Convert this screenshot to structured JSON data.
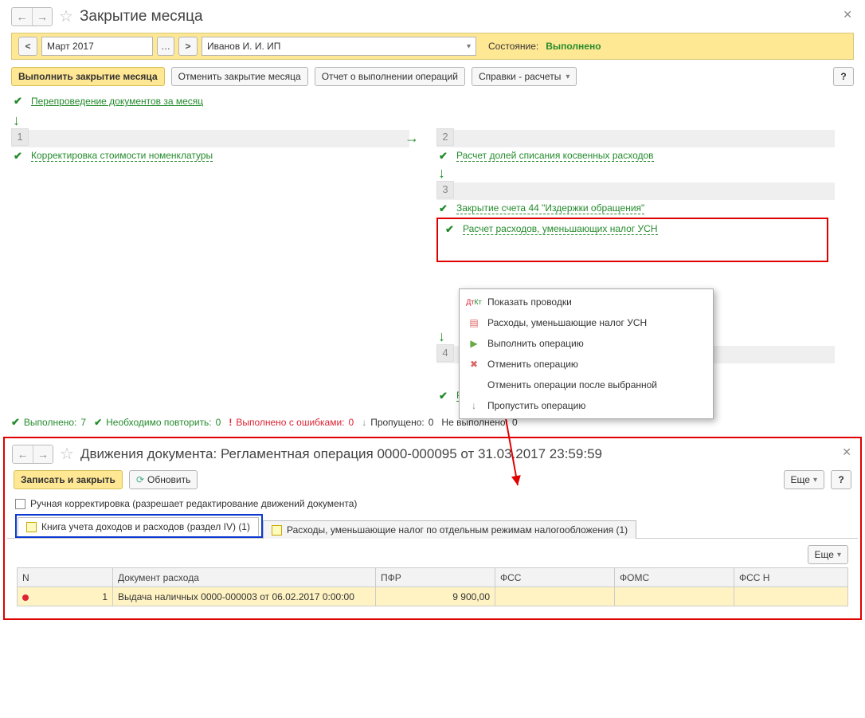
{
  "header": {
    "title": "Закрытие месяца"
  },
  "bar1": {
    "period": "Март 2017",
    "org": "Иванов И. И. ИП",
    "state_label": "Состояние:",
    "state_value": "Выполнено"
  },
  "bar2": {
    "run": "Выполнить закрытие месяца",
    "cancel": "Отменить закрытие месяца",
    "report": "Отчет о выполнении операций",
    "refs": "Справки - расчеты",
    "help": "?"
  },
  "steps": {
    "reposting": "Перепроведение документов за месяц",
    "s1": "Корректировка стоимости номенклатуры",
    "s2": "Расчет долей списания косвенных расходов",
    "s3a": "Закрытие счета 44 \"Издержки обращения\"",
    "s3b": "Расчет расходов, уменьшающих налог УСН",
    "s4": "Расчет налога УСН"
  },
  "menu": {
    "m1": "Показать проводки",
    "m2": "Расходы, уменьшающие налог УСН",
    "m3": "Выполнить операцию",
    "m4": "Отменить операцию",
    "m5": "Отменить операции после выбранной",
    "m6": "Пропустить операцию"
  },
  "statusbar": {
    "done": "Выполнено:",
    "done_n": "7",
    "repeat": "Необходимо повторить:",
    "repeat_n": "0",
    "err": "Выполнено с ошибками:",
    "err_n": "0",
    "skip": "Пропущено:",
    "skip_n": "0",
    "nd": "Не выполнено:",
    "nd_n": "0"
  },
  "panel2": {
    "title": "Движения документа: Регламентная операция 0000-000095 от 31.03.2017 23:59:59",
    "save": "Записать и закрыть",
    "refresh": "Обновить",
    "more": "Еще",
    "help": "?",
    "manual": "Ручная корректировка (разрешает редактирование движений документа)",
    "tab1": "Книга учета доходов и расходов (раздел IV) (1)",
    "tab2": "Расходы, уменьшающие налог по отдельным режимам налогообложения (1)",
    "cols": {
      "n": "N",
      "doc": "Документ расхода",
      "pfr": "ПФР",
      "fss": "ФСС",
      "foms": "ФОМС",
      "fssn": "ФСС Н"
    },
    "row": {
      "n": "1",
      "doc": "Выдача наличных 0000-000003 от 06.02.2017 0:00:00",
      "pfr": "9 900,00"
    }
  }
}
